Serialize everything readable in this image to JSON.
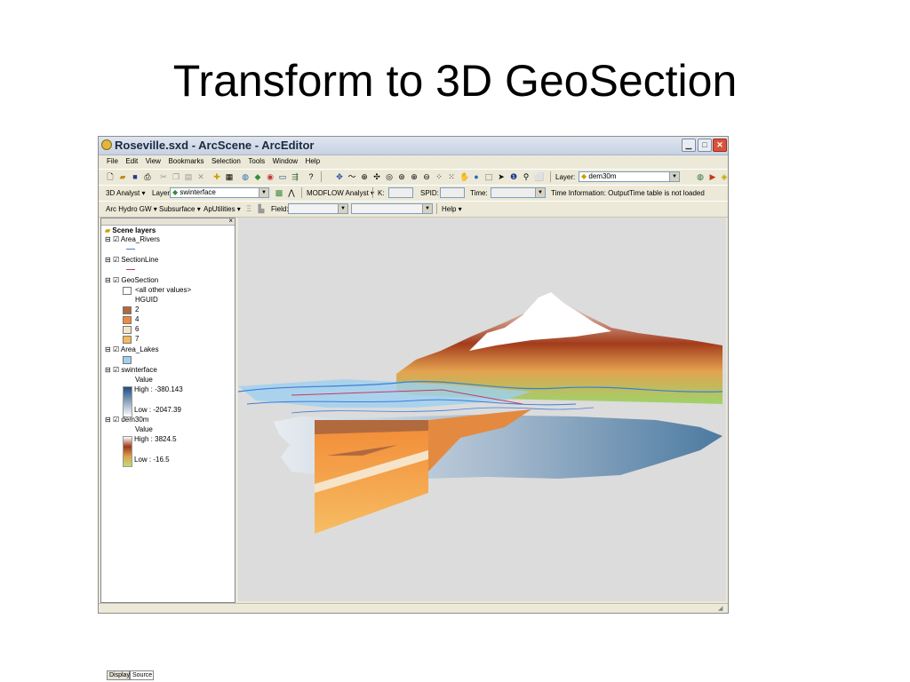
{
  "slide": {
    "title": "Transform to 3D GeoSection"
  },
  "window": {
    "title": "Roseville.sxd - ArcScene - ArcEditor"
  },
  "menu": [
    "File",
    "Edit",
    "View",
    "Bookmarks",
    "Selection",
    "Tools",
    "Window",
    "Help"
  ],
  "toolbar1": {
    "layer_label": "Layer:",
    "layer_value": "dem30m"
  },
  "toolbar2": {
    "analyst": "3D Analyst ▾",
    "layer_label": "Layer:",
    "layer_value": "swinterface",
    "modflow": "MODFLOW Analyst ▾",
    "k_label": "K:",
    "spid_label": "SPID:",
    "time_label": "Time:",
    "time_info": "Time Information: OutputTime table is not loaded"
  },
  "toolbar3": {
    "archydro": "Arc Hydro GW ▾",
    "subsurface": "Subsurface ▾",
    "aputilities": "ApUtilities ▾",
    "field_label": "Field:",
    "help": "Help ▾"
  },
  "toc": {
    "root": "Scene layers",
    "layers": {
      "area_rivers": "Area_Rivers",
      "sectionline": "SectionLine",
      "geosection": "GeoSection",
      "geosection_other": "<all other values>",
      "geosection_field": "HGUID",
      "geosection_classes": [
        {
          "label": "2",
          "color": "#b06a3e"
        },
        {
          "label": "4",
          "color": "#f08a3a"
        },
        {
          "label": "6",
          "color": "#f6e4c8"
        },
        {
          "label": "7",
          "color": "#f6b85c"
        }
      ],
      "area_lakes": "Area_Lakes",
      "swinterface": "swinterface",
      "sw_value": "Value",
      "sw_high": "High : -380.143",
      "sw_low": "Low : -2047.39",
      "dem30m": "dem30m",
      "dem_value": "Value",
      "dem_high": "High : 3824.5",
      "dem_low": "Low : -16.5"
    }
  },
  "tabs": {
    "display": "Display",
    "source": "Source"
  },
  "colors": {
    "rivers": "#3a7fd8",
    "lakes": "#9fd0f0",
    "dem_high": "#ffffff",
    "dem_mid": "#9a3a1a",
    "dem_low": "#b7e07a"
  }
}
